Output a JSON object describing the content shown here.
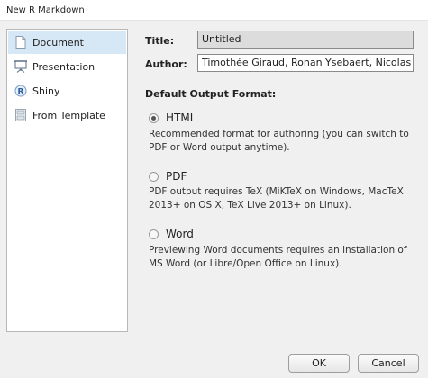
{
  "window": {
    "title": "New R Markdown"
  },
  "sidebar": {
    "items": [
      {
        "label": "Document",
        "icon": "document-icon",
        "active": true
      },
      {
        "label": "Presentation",
        "icon": "presentation-icon",
        "active": false
      },
      {
        "label": "Shiny",
        "icon": "shiny-icon",
        "active": false
      },
      {
        "label": "From Template",
        "icon": "template-icon",
        "active": false
      }
    ]
  },
  "form": {
    "title_label": "Title:",
    "title_value": "Untitled",
    "author_label": "Author:",
    "author_value": "Timothée Giraud, Ronan Ysebaert, Nicolas Lambert"
  },
  "output": {
    "heading": "Default Output Format:",
    "options": [
      {
        "label": "HTML",
        "selected": true,
        "description": "Recommended format for authoring (you can switch to PDF or Word output anytime)."
      },
      {
        "label": "PDF",
        "selected": false,
        "description": "PDF output requires TeX (MiKTeX on Windows, MacTeX 2013+ on OS X, TeX Live 2013+ on Linux)."
      },
      {
        "label": "Word",
        "selected": false,
        "description": "Previewing Word documents requires an installation of MS Word (or Libre/Open Office on Linux)."
      }
    ]
  },
  "buttons": {
    "ok": "OK",
    "cancel": "Cancel"
  },
  "colors": {
    "active_item": "#d6e7f6",
    "window_bg": "#f0f0f0"
  }
}
